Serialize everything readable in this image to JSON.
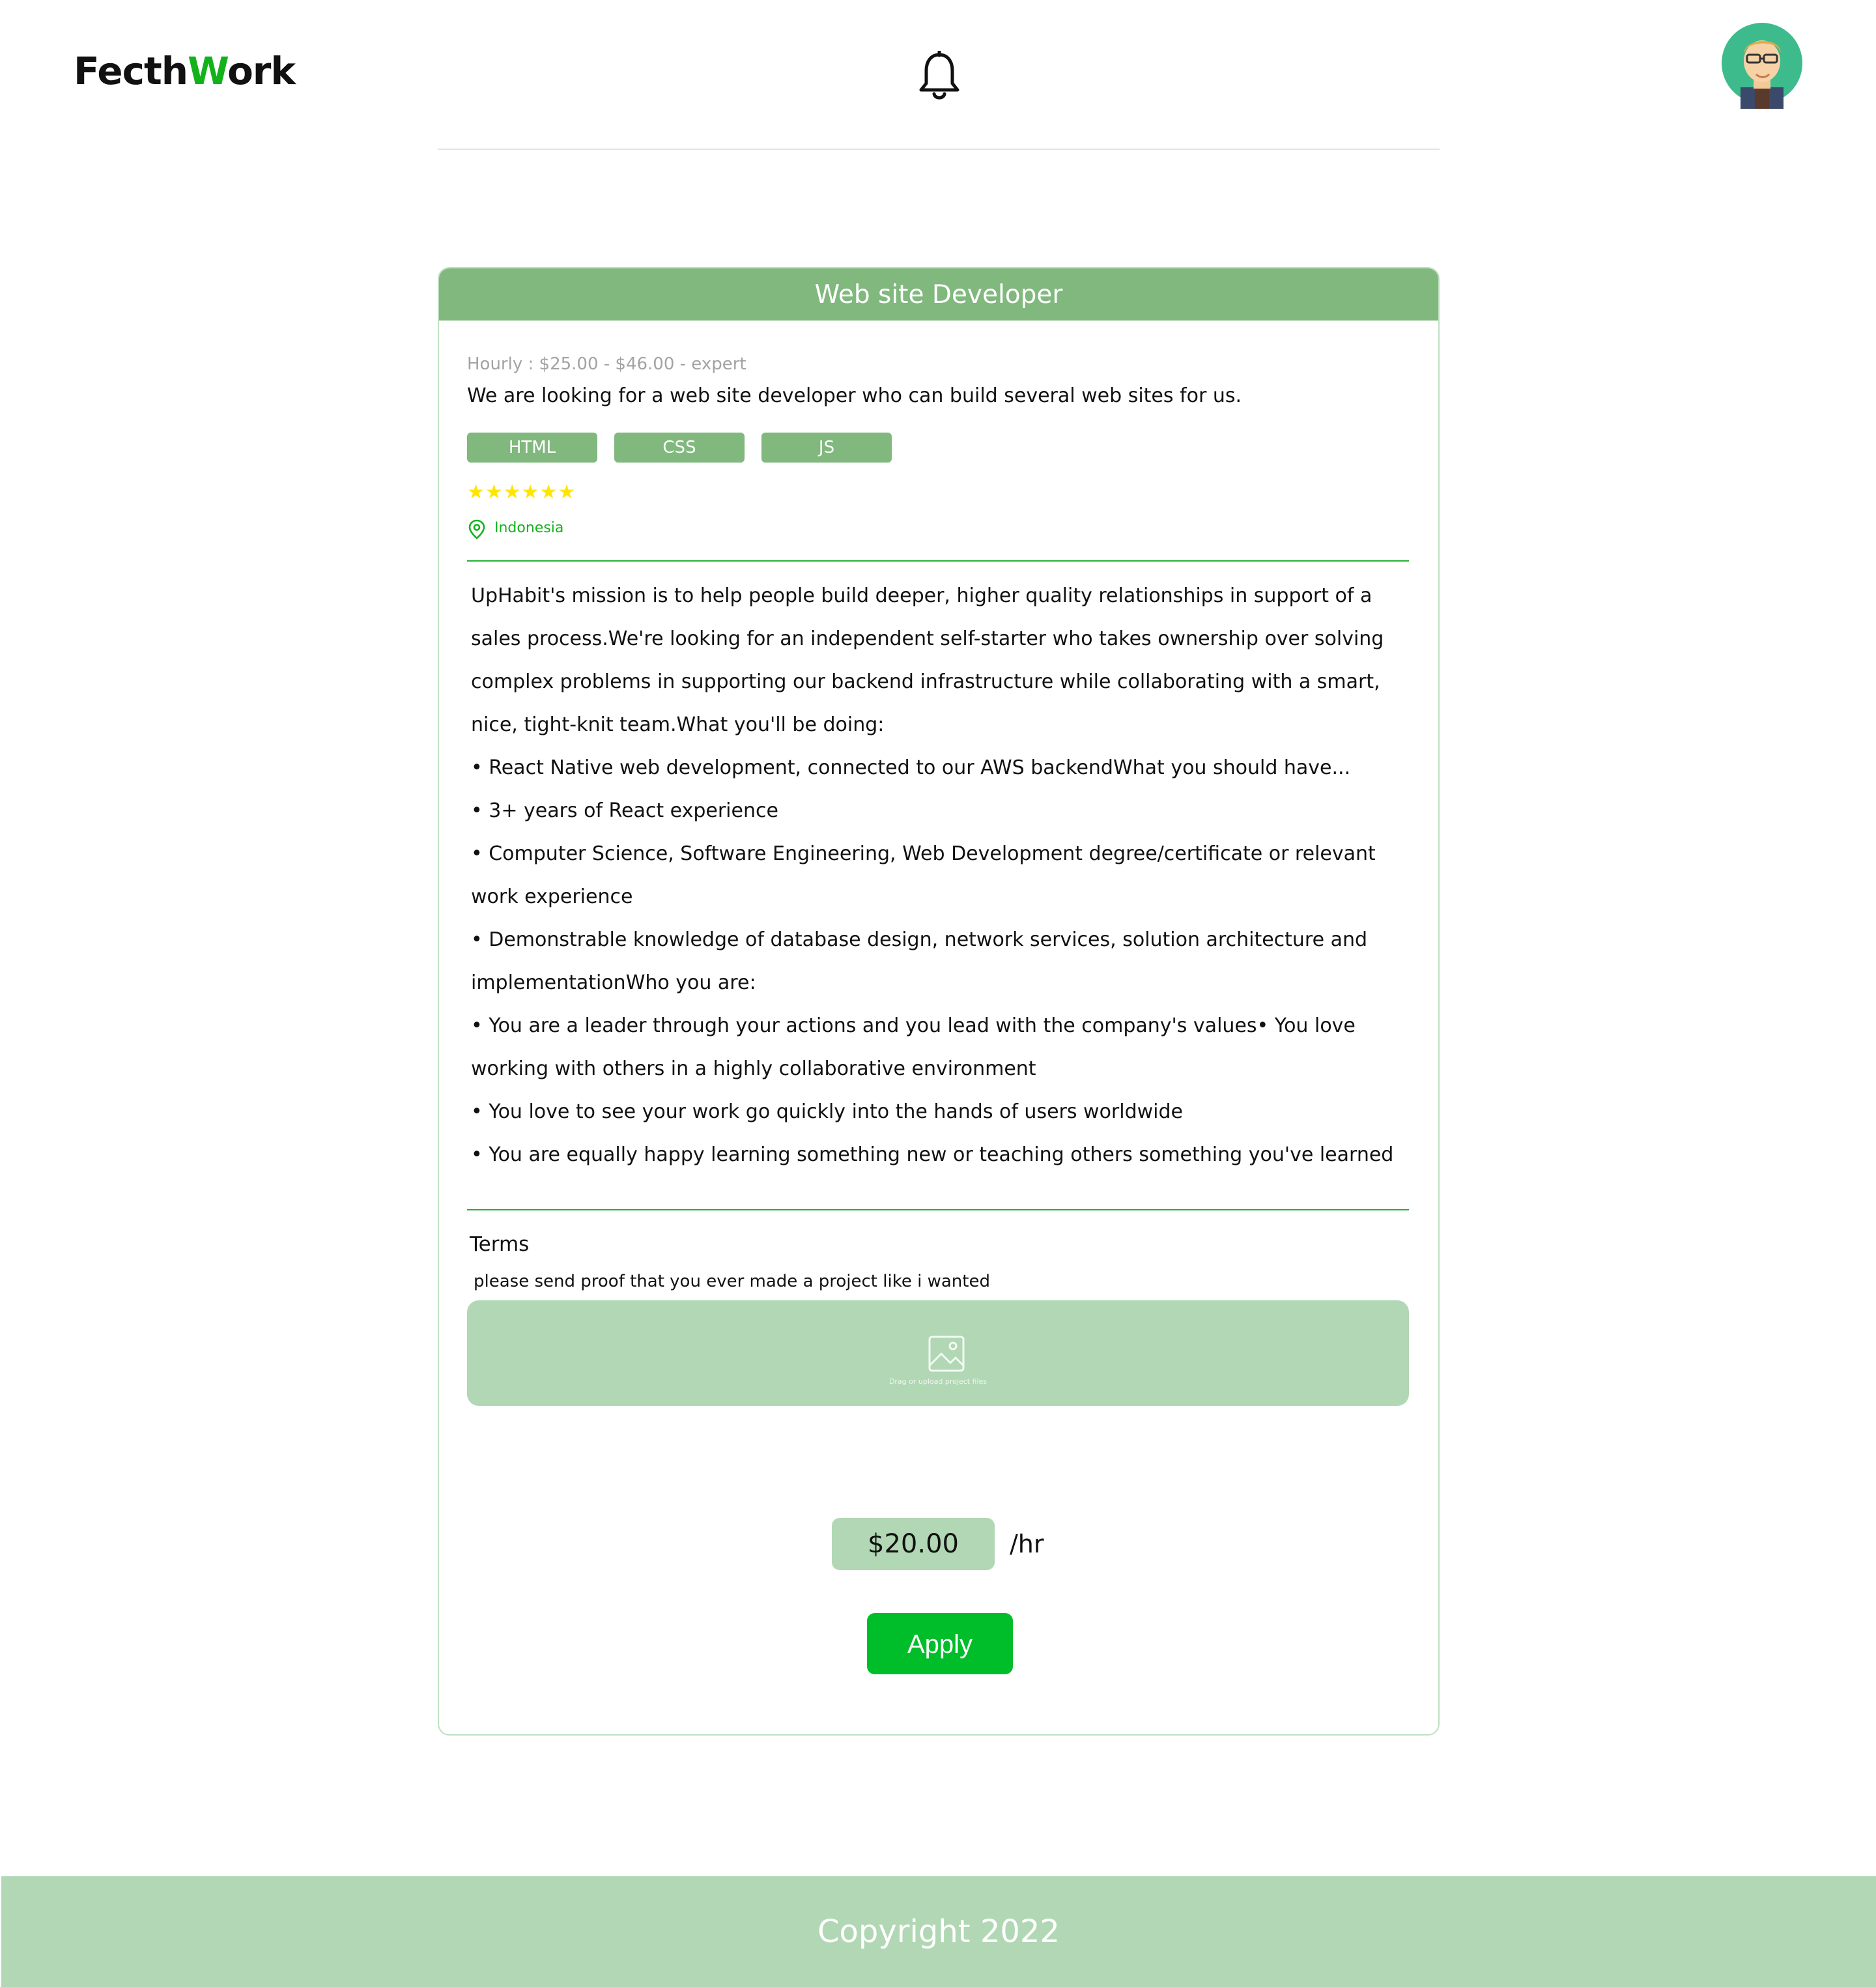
{
  "header": {
    "logo_part1": "Fecth",
    "logo_part2": "W",
    "logo_part3": "ork"
  },
  "job": {
    "title": "Web site Developer",
    "rate_range": "Hourly : $25.00 - $46.00 - expert",
    "summary": "We are looking for a web site developer who can build several web sites for us.",
    "tags": [
      "HTML",
      "CSS",
      "JS"
    ],
    "rating_stars": "★★★★★★",
    "rating": 6,
    "location": "Indonesia",
    "description_lines": [
      "UpHabit's mission is to help people build deeper, higher quality relationships in support of a",
      "sales process.We're looking for an independent self-starter who takes ownership over solving",
      "complex problems in supporting our backend infrastructure while collaborating with a smart,",
      "nice, tight-knit team.What you'll be doing:",
      "• React Native web development, connected to our AWS backendWhat you should have...",
      "• 3+ years of React experience",
      "• Computer Science, Software Engineering, Web Development degree/certificate or relevant",
      "work experience",
      "• Demonstrable knowledge of database design, network services, solution architecture and",
      "implementationWho you are:",
      "• You are a leader through your actions and you lead with the company's values• You love",
      "working with others in a highly collaborative environment",
      "• You love to see your work go quickly into the hands of users worldwide",
      "• You are equally happy learning something new or teaching others something you've learned"
    ]
  },
  "terms": {
    "title": "Terms",
    "text": "please send proof that you ever made a project like i wanted"
  },
  "upload": {
    "hint": "Drag or upload project files",
    "icon": "image-icon"
  },
  "bid": {
    "price": "$20.00",
    "unit": "/hr",
    "apply_label": "Apply"
  },
  "footer": {
    "copyright": "Copyright 2022"
  },
  "colors": {
    "brand_green": "#12b21b",
    "header_green": "#80b87e",
    "light_green": "#b1d7b4",
    "apply_green": "#00bd2a",
    "star_yellow": "#ffe600"
  }
}
